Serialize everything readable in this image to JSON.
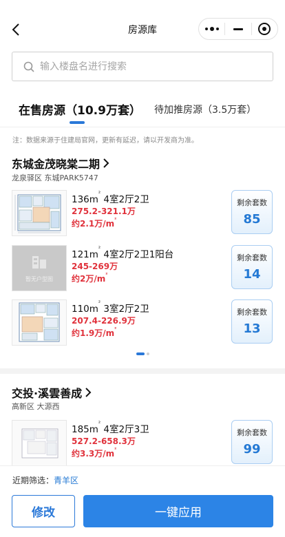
{
  "nav": {
    "title": "房源库"
  },
  "search": {
    "placeholder": "输入楼盘名进行搜索"
  },
  "tabs": [
    {
      "label": "在售房源（10.9万套）",
      "active": true
    },
    {
      "label": "待加推房源（3.5万套）",
      "active": false
    }
  ],
  "notice": "注：数据来源于住建局官网，更新有延迟，请以开发商为准。",
  "projects": [
    {
      "name": "东城金茂晓棠二期",
      "location": "龙泉驿区 东城PARK5747",
      "units": [
        {
          "area": "136m",
          "layout": " 4室2厅2卫",
          "price": "275.2-321.1万",
          "avg": "约2.1万/m",
          "remain_label": "剩余套数",
          "remain": "85",
          "thumb": "floorplan"
        },
        {
          "area": "121m",
          "layout": " 4室2厅2卫1阳台",
          "price": "245-269万",
          "avg": "约2万/m",
          "remain_label": "剩余套数",
          "remain": "14",
          "thumb": "placeholder",
          "thumb_text": "暂无户型图"
        },
        {
          "area": "110m",
          "layout": " 3室2厅2卫",
          "price": "207.4-226.9万",
          "avg": "约1.9万/m",
          "remain_label": "剩余套数",
          "remain": "13",
          "thumb": "floorplan"
        }
      ]
    },
    {
      "name": "交投·溪雲善成",
      "location": "高新区 大源西",
      "units": [
        {
          "area": "185m",
          "layout": " 4室2厅3卫",
          "price": "527.2-658.3万",
          "avg": "约3.3万/m",
          "remain_label": "剩余套数",
          "remain": "99",
          "thumb": "floorplan"
        }
      ]
    }
  ],
  "superscript": "²",
  "bottom": {
    "filter_label": "近期筛选：",
    "filter_value": "青羊区",
    "edit_label": "修改",
    "apply_label": "一键应用"
  },
  "colors": {
    "accent": "#2a78d8",
    "price": "#e0323c"
  }
}
